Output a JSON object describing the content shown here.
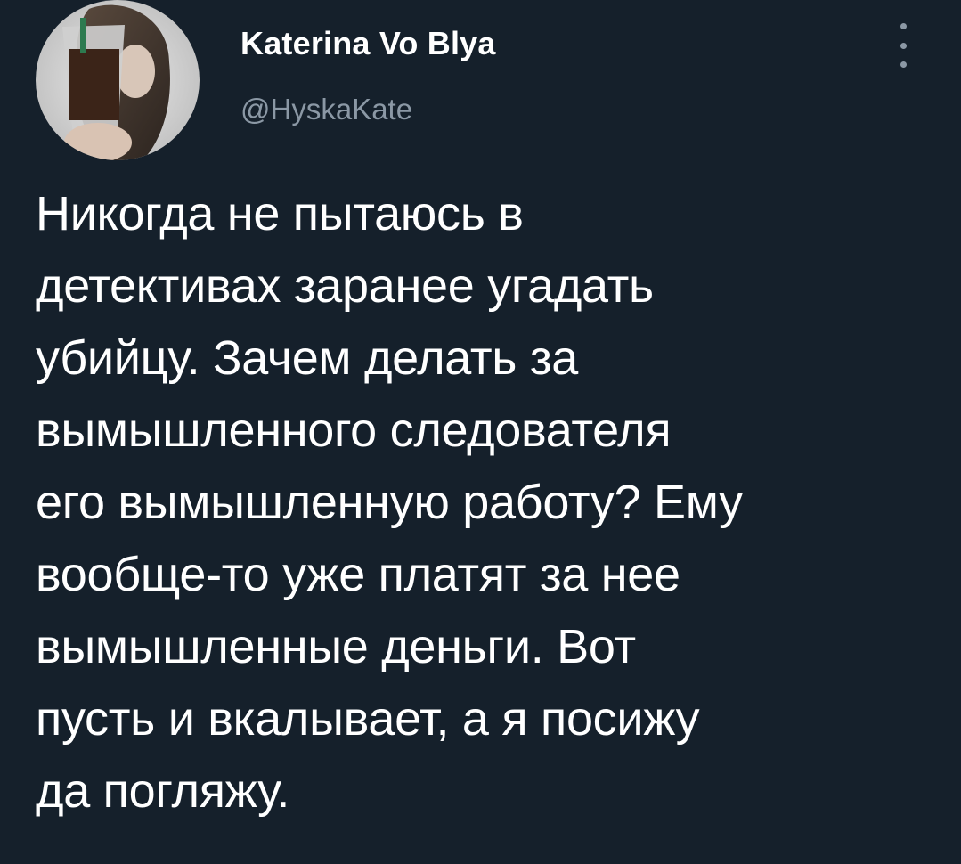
{
  "author": {
    "display_name": "Katerina Vo Blya",
    "handle": "@HyskaKate",
    "avatar_icon": "avatar-photo"
  },
  "menu": {
    "icon": "more-options-icon"
  },
  "tweet": {
    "text": "Никогда не пытаюсь в\nдетективах заранее угадать\nубийцу. Зачем делать за\nвымышленного следователя\nего вымышленную работу? Ему\nвообще-то уже платят за нее\nвымышленные деньги. Вот\nпусть и вкалывает, а я посижу\nда погляжу."
  },
  "colors": {
    "background": "#15202b",
    "text": "#ffffff",
    "secondary_text": "#8b98a5"
  }
}
